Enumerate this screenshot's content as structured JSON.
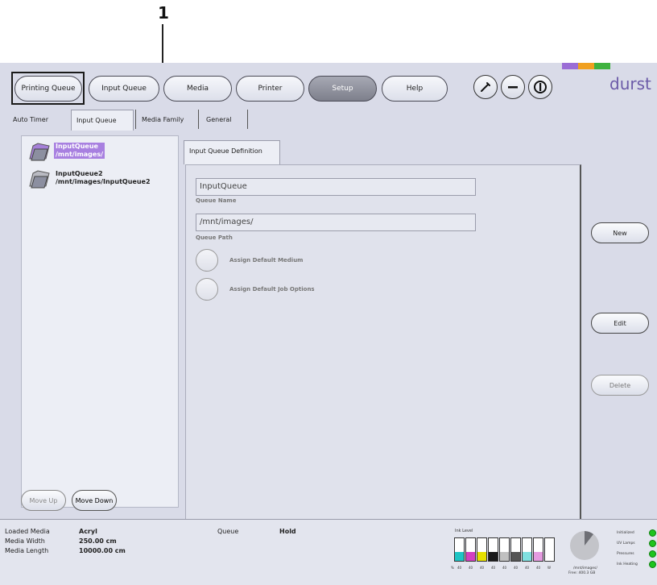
{
  "callout": {
    "number": "1"
  },
  "nav": {
    "buttons": [
      {
        "label": "Printing Queue"
      },
      {
        "label": "Input Queue"
      },
      {
        "label": "Media"
      },
      {
        "label": "Printer"
      },
      {
        "label": "Setup"
      },
      {
        "label": "Help"
      }
    ],
    "icons": [
      "wrench-icon",
      "minus-icon",
      "power-icon"
    ]
  },
  "brand": {
    "name": "durst",
    "colors": [
      "#9b6dd6",
      "#f0a020",
      "#3fb23f"
    ]
  },
  "tabs": [
    {
      "label": "Auto Timer"
    },
    {
      "label": "Input Queue"
    },
    {
      "label": "Media Family"
    },
    {
      "label": "General"
    }
  ],
  "queues": [
    {
      "name": "InputQueue",
      "path": "/mnt/images/"
    },
    {
      "name": "InputQueue2",
      "path": "/mnt/images/InputQueue2"
    }
  ],
  "left_buttons": {
    "move_up": "Move Up",
    "move_down": "Move Down"
  },
  "definition": {
    "tab_label": "Input Queue Definition",
    "queue_name_value": "InputQueue",
    "queue_name_label": "Queue Name",
    "queue_path_value": "/mnt/images/",
    "queue_path_label": "Queue Path",
    "assign_medium": "Assign Default Medium",
    "assign_job_options": "Assign Default Job Options"
  },
  "side_buttons": {
    "new": "New",
    "edit": "Edit",
    "delete": "Delete"
  },
  "status": {
    "loaded_media_label": "Loaded Media",
    "loaded_media_value": "Acryl",
    "media_width_label": "Media Width",
    "media_width_value": "250.00 cm",
    "media_length_label": "Media Length",
    "media_length_value": "10000.00 cm",
    "queue_label": "Queue",
    "queue_value": "Hold",
    "ink_level_title": "Ink Level",
    "ink_percent_label": "%",
    "inks": [
      {
        "color": "#1ec4c4",
        "level": 40,
        "label": "40"
      },
      {
        "color": "#d43fc1",
        "level": 40,
        "label": "40"
      },
      {
        "color": "#e6e000",
        "level": 40,
        "label": "40"
      },
      {
        "color": "#1a1a1a",
        "level": 40,
        "label": "40"
      },
      {
        "color": "#c0c0c0",
        "level": 40,
        "label": "40"
      },
      {
        "color": "#555555",
        "level": 40,
        "label": "40"
      },
      {
        "color": "#7fe0e0",
        "level": 40,
        "label": "40"
      },
      {
        "color": "#e59be0",
        "level": 40,
        "label": "40"
      },
      {
        "color": "#f2f2f2",
        "level": 0,
        "label": "W"
      }
    ],
    "disk_path": "/mnt/images/",
    "disk_free": "Free: 400.3 GB",
    "indicators": [
      "Initialized",
      "UV Lamps",
      "Pressures",
      "Ink Heating"
    ]
  }
}
